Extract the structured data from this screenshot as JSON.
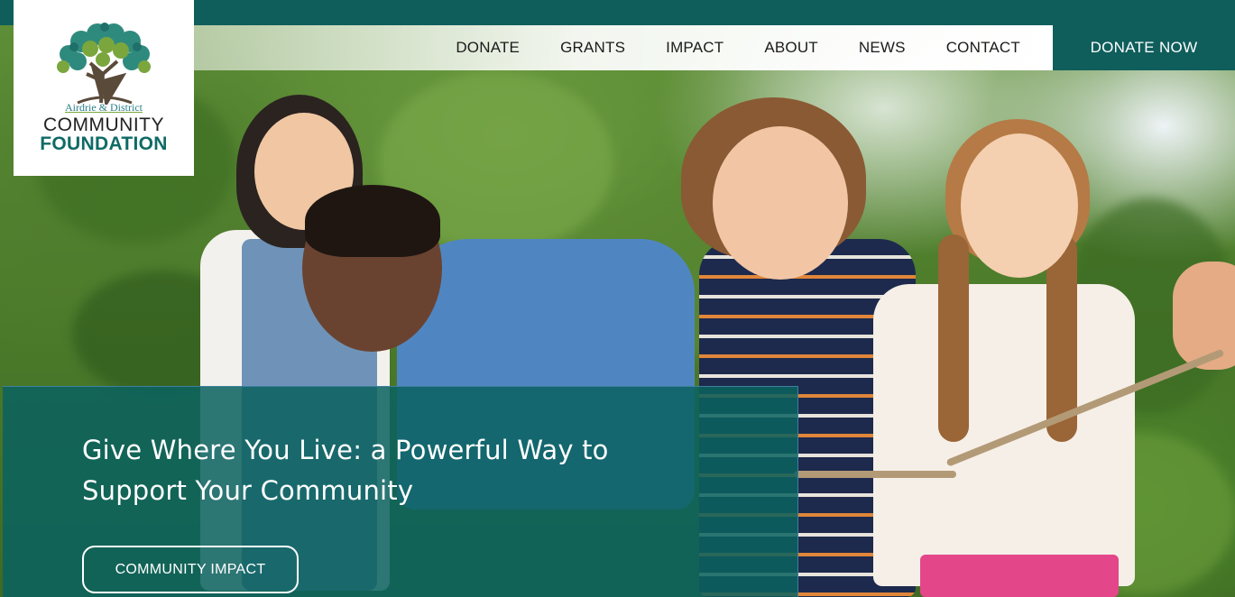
{
  "header": {
    "logo": {
      "small_text": "Airdrie & District",
      "line1": "COMMUNITY",
      "line2": "FOUNDATION",
      "colors": {
        "teal": "#0f6a66",
        "leaf_green": "#7aa63d",
        "trunk": "#5a4a3a"
      }
    },
    "nav": [
      "DONATE",
      "GRANTS",
      "IMPACT",
      "ABOUT",
      "NEWS",
      "CONTACT"
    ],
    "cta": "DONATE NOW",
    "accent": "#0f5e5c"
  },
  "hero": {
    "title": "Give Where You Live: a Powerful Way to Support Your Community",
    "button": "COMMUNITY IMPACT",
    "image": "children-playing-tug-of-war-photo",
    "panel_color": "#0a6260"
  }
}
